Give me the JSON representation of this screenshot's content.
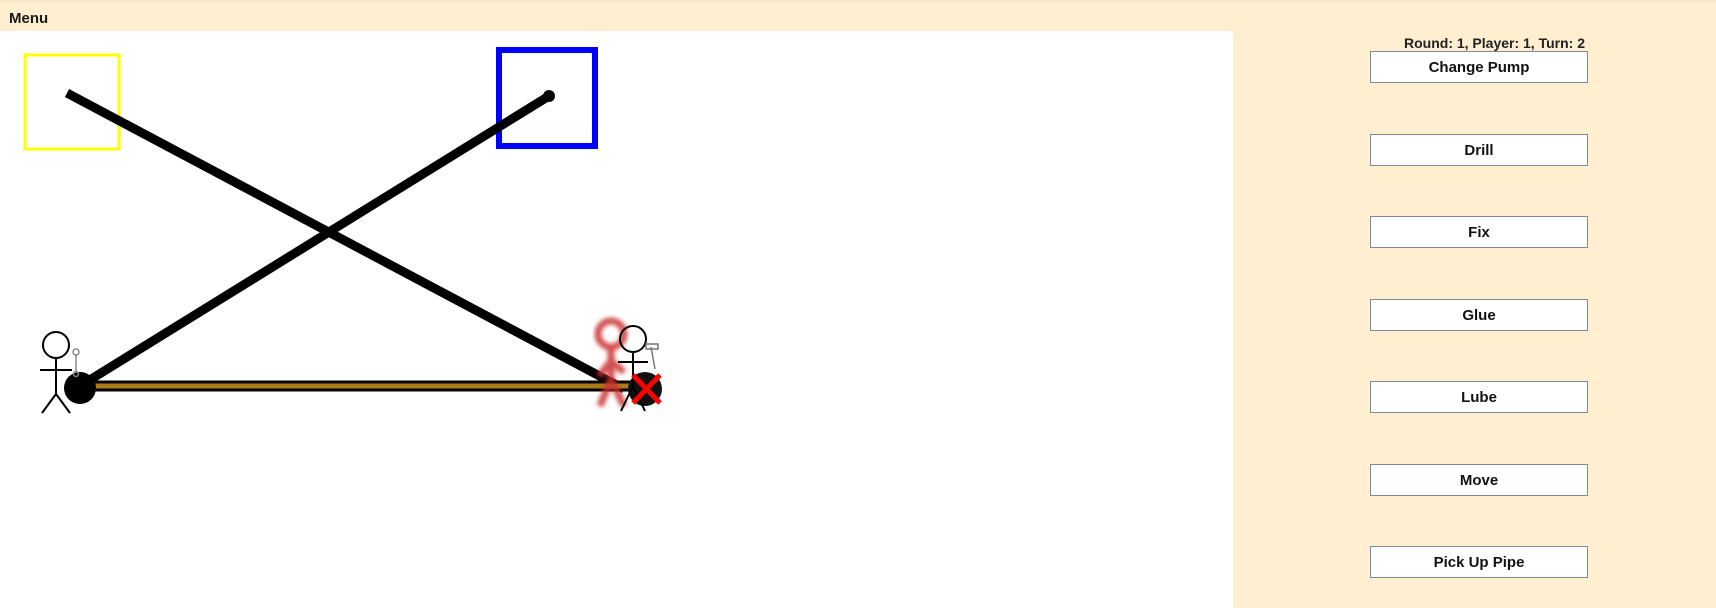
{
  "menubar": {
    "menu_label": "Menu"
  },
  "status": {
    "text": "Round: 1, Player: 1, Turn: 2"
  },
  "actions": [
    {
      "label": "Change Pump"
    },
    {
      "label": "Drill"
    },
    {
      "label": "Fix"
    },
    {
      "label": "Glue"
    },
    {
      "label": "Lube"
    },
    {
      "label": "Move"
    },
    {
      "label": "Pick Up Pipe"
    }
  ],
  "board": {
    "source_color": "#ffff00",
    "cistern_color": "#0000ff",
    "pipe_color": "#000000",
    "oil_pipe_color": "#b07a18",
    "broken_marker_color": "#ff0000",
    "ghost_color": "#cc3333",
    "icons": [
      "wrench-icon",
      "hammer-icon",
      "broken-pipe-icon"
    ]
  },
  "colors": {
    "background": "#ffeed0",
    "board_background": "#ffffff",
    "button_border": "#7d8a99"
  }
}
